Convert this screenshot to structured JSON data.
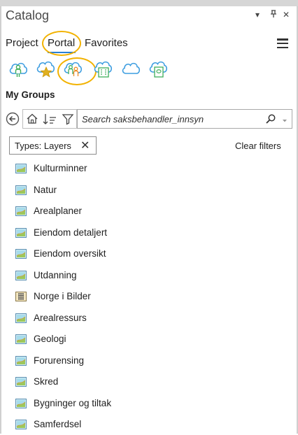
{
  "pane": {
    "title": "Catalog",
    "controls": {
      "dropdown": "▾",
      "pin": "⊓",
      "close": "✕"
    }
  },
  "tabs": [
    {
      "label": "Project"
    },
    {
      "label": "Portal"
    },
    {
      "label": "Favorites"
    }
  ],
  "active_tab": "Portal",
  "portal_sources": [
    {
      "icon": "my-content-cloud-icon"
    },
    {
      "icon": "favorites-cloud-icon"
    },
    {
      "icon": "my-groups-cloud-icon"
    },
    {
      "icon": "my-organization-cloud-icon"
    },
    {
      "icon": "arcgis-online-cloud-icon"
    },
    {
      "icon": "living-atlas-cloud-icon"
    }
  ],
  "section": {
    "title": "My Groups"
  },
  "search": {
    "placeholder": "Search saksbehandler_innsyn"
  },
  "filter": {
    "chip_label": "Types: Layers",
    "clear_label": "Clear filters"
  },
  "items": [
    {
      "label": "Kulturminner",
      "icon": "layer-icon"
    },
    {
      "label": "Natur",
      "icon": "layer-icon"
    },
    {
      "label": "Arealplaner",
      "icon": "layer-icon"
    },
    {
      "label": "Eiendom detaljert",
      "icon": "layer-icon"
    },
    {
      "label": "Eiendom oversikt",
      "icon": "layer-icon"
    },
    {
      "label": "Utdanning",
      "icon": "layer-icon"
    },
    {
      "label": "Norge i Bilder",
      "icon": "tile-layer-icon"
    },
    {
      "label": "Arealressurs",
      "icon": "layer-icon"
    },
    {
      "label": "Geologi",
      "icon": "layer-icon"
    },
    {
      "label": "Forurensing",
      "icon": "layer-icon"
    },
    {
      "label": "Skred",
      "icon": "layer-icon"
    },
    {
      "label": "Bygninger og tiltak",
      "icon": "layer-icon"
    },
    {
      "label": "Samferdsel",
      "icon": "layer-icon"
    }
  ],
  "colors": {
    "highlight": "#f2b200",
    "tab_underline": "#2a7fd4",
    "cloud_blue": "#3d9de0",
    "accent_green": "#3fae5a",
    "accent_orange": "#f08a24"
  }
}
